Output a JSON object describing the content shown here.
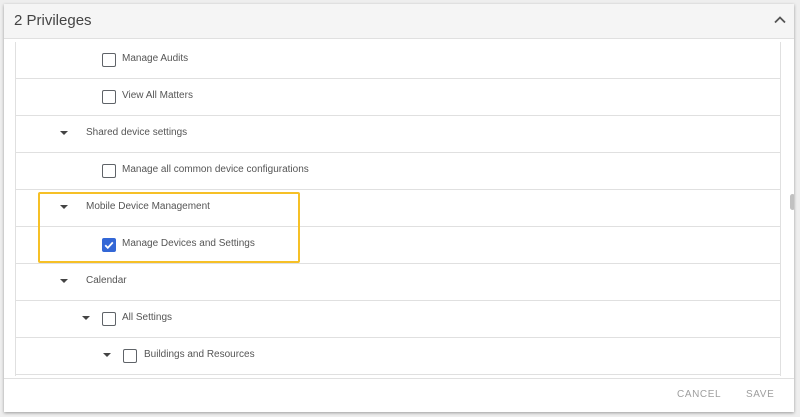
{
  "header": {
    "title": "2 Privileges"
  },
  "privileges": {
    "rows": [
      {
        "label": "Manage Audits",
        "checked": false
      },
      {
        "label": "View All Matters",
        "checked": false
      },
      {
        "label": "Shared device settings"
      },
      {
        "label": "Manage all common device configurations",
        "checked": false
      },
      {
        "label": "Mobile Device Management"
      },
      {
        "label": "Manage Devices and Settings",
        "checked": true
      },
      {
        "label": "Calendar"
      },
      {
        "label": "All Settings",
        "checked": false
      },
      {
        "label": "Buildings and Resources",
        "checked": false
      }
    ]
  },
  "footer": {
    "cancel_label": "CANCEL",
    "save_label": "SAVE"
  },
  "colors": {
    "highlight": "#f6c026",
    "checkbox_checked": "#3367d6"
  },
  "icons": {
    "collapse": "chevron-up-icon",
    "expand": "caret-down-icon",
    "check": "check-icon"
  }
}
